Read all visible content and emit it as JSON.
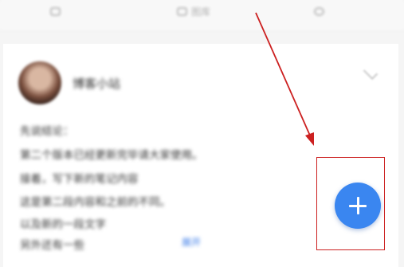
{
  "top_tabs": [
    {
      "icon": "edit-icon",
      "label": ""
    },
    {
      "icon": "image-icon",
      "label": "图库"
    },
    {
      "icon": "link-icon",
      "label": ""
    }
  ],
  "post": {
    "username": "博客小站",
    "lines": [
      "先说结论：",
      "第二个版本已经更新完毕请大家使用。",
      "接着，写下新的笔记内容",
      "这是第二段内容和之前的不同。",
      "以及新的一段文字",
      "另外还有一些"
    ],
    "link_label": "展开"
  },
  "fab": {
    "icon": "plus-icon"
  },
  "annotation": {
    "color": "#cc2020"
  },
  "colors": {
    "accent": "#3a86f0",
    "link": "#3a7be8"
  }
}
